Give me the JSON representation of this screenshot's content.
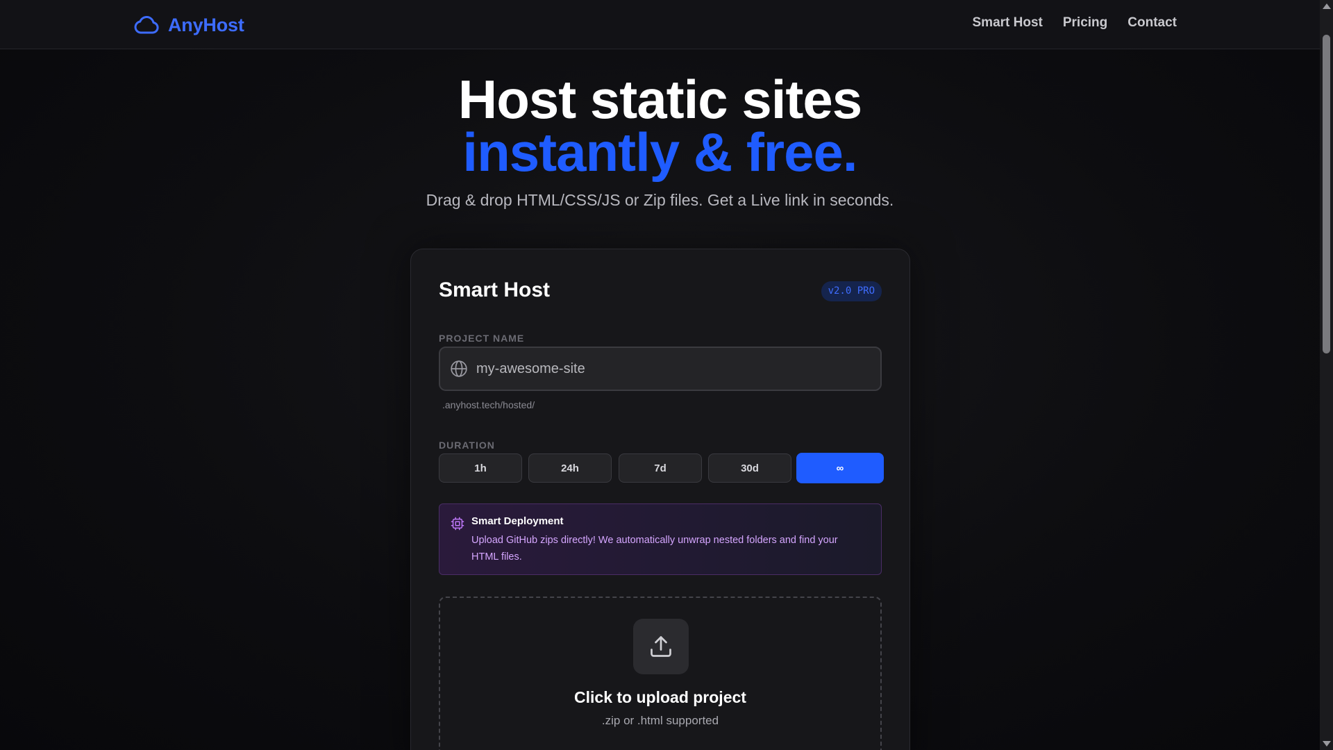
{
  "brand": {
    "name": "AnyHost",
    "accent": "#3d6cff"
  },
  "nav": {
    "items": [
      "Smart Host",
      "Pricing",
      "Contact"
    ]
  },
  "hero": {
    "line1": "Host static sites",
    "line2": "instantly & free.",
    "subtitle": "Drag & drop HTML/CSS/JS or Zip files. Get a Live link in seconds."
  },
  "card": {
    "title": "Smart Host",
    "badge": "v2.0 PRO",
    "project_label": "PROJECT NAME",
    "project_placeholder": "my-awesome-site",
    "project_value": "",
    "domain_hint": ".anyhost.tech/hosted/",
    "duration_label": "DURATION",
    "durations": [
      "1h",
      "24h",
      "7d",
      "30d",
      "∞"
    ],
    "selected_duration": "∞",
    "info": {
      "title": "Smart Deployment",
      "text": "Upload GitHub zips directly! We automatically unwrap nested folders and find your HTML files."
    },
    "upload": {
      "title": "Click to upload project",
      "subtitle": ".zip or .html supported"
    }
  },
  "colors": {
    "primary": "#1f5cff",
    "background": "#0d0d10",
    "card": "#17171a",
    "info_text": "#d5a6ff"
  },
  "icons": {
    "logo": "cloud-icon",
    "project_field": "globe-icon",
    "info": "chip-icon",
    "upload": "upload-icon"
  }
}
